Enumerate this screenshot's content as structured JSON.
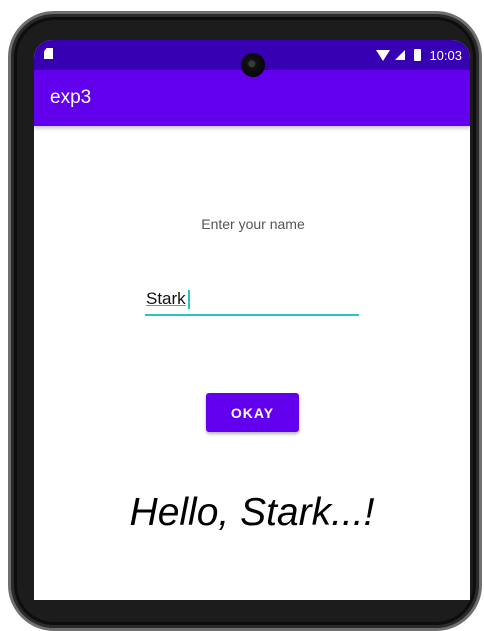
{
  "status_bar": {
    "time": "10:03",
    "icons": [
      "sd-card-icon",
      "wifi-icon",
      "signal-icon",
      "battery-icon"
    ]
  },
  "app_bar": {
    "title": "exp3",
    "color": "#6200ee"
  },
  "form": {
    "prompt": "Enter your name",
    "name_value": "Stark",
    "button_label": "OKAY",
    "accent": "#26c6c0"
  },
  "result": {
    "greeting": "Hello, Stark...!"
  }
}
